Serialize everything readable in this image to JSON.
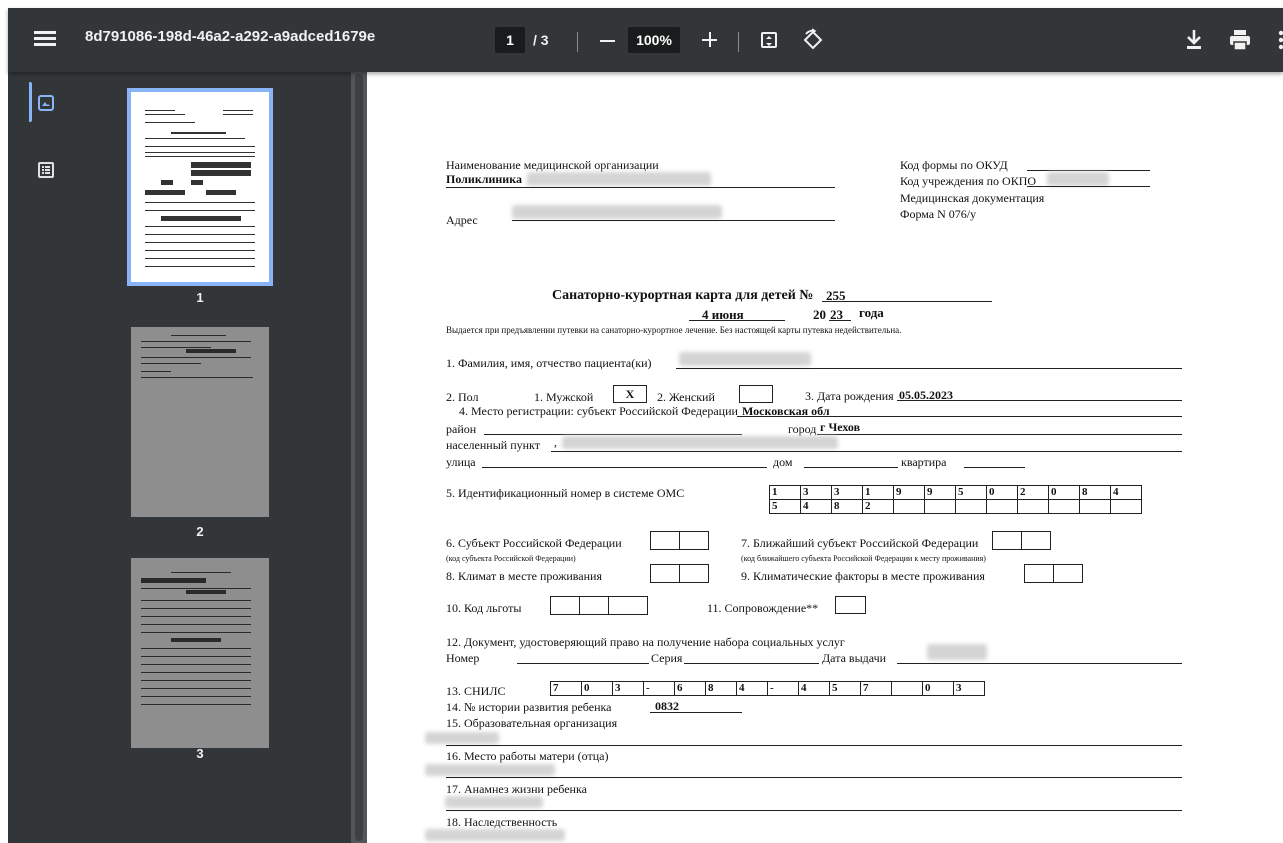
{
  "toolbar": {
    "file_name": "8d791086-198d-46a2-a292-a9adced1679e",
    "page_current": "1",
    "page_total": "/ 3",
    "zoom": "100%"
  },
  "sidebar": {
    "thumbnails": [
      {
        "label": "1"
      },
      {
        "label": "2"
      },
      {
        "label": "3"
      }
    ]
  },
  "doc": {
    "org_label": "Наименование медицинской организации",
    "org_name": "Поликлиника",
    "address_label": "Адрес",
    "okud_label": "Код формы по ОКУД",
    "okpo_label": "Код учреждения по ОКПО",
    "meddoc_label": "Медицинская документация",
    "form_label": "Форма N 076/у",
    "title": "Санаторно-курортная карта для детей №",
    "card_number": "255",
    "date_day": "4 июня",
    "year_prefix": "20",
    "year_suffix": "23",
    "year_word": "года",
    "issue_note": "Выдается при предъявлении путевки на санаторно-курортное лечение. Без настоящей карты путевка недействительна.",
    "f1": "1. Фамилия, имя, отчество пациента(ки)",
    "f2": "2. Пол",
    "male": "1. Мужской",
    "male_mark": "X",
    "female": "2. Женский",
    "birth_label": "3. Дата рождения",
    "birth_value": "05.05.2023",
    "f4": "4. Место регистрации: субъект Российской Федерации",
    "region_value": "Московская обл",
    "district": "район",
    "city_label": "город",
    "city_value": "г Чехов",
    "settlement": "населенный пункт",
    "settlement_value": ",",
    "street": "улица",
    "house": "дом",
    "flat": "квартира",
    "f5": "5. Идентификационный номер в системе ОМС",
    "oms_row1": [
      "1",
      "3",
      "3",
      "1",
      "9",
      "9",
      "5",
      "0",
      "2",
      "0",
      "8",
      "4"
    ],
    "oms_row2": [
      "5",
      "4",
      "8",
      "2",
      "",
      "",
      "",
      "",
      "",
      "",
      "",
      ""
    ],
    "f6": "6. Субъект Российской Федерации",
    "f6_note": "(код субъекта Российской Федерации)",
    "f7": "7. Ближайший субъект Российской Федерации",
    "f7_note": "(код ближайшего субъекта Российской Федерации к месту проживания)",
    "f8": "8. Климат в месте проживания",
    "f9": "9. Климатические факторы в месте проживания",
    "f10": "10. Код льготы",
    "f11": "11. Сопровождение**",
    "f12": "12. Документ, удостоверяющий право на получение набора социальных услуг",
    "number": "Номер",
    "series": "Серия",
    "issue_date": "Дата выдачи",
    "f13": "13. СНИЛС",
    "snils": [
      "7",
      "0",
      "3",
      "-",
      "6",
      "8",
      "4",
      "-",
      "4",
      "5",
      "7",
      "",
      "0",
      "3"
    ],
    "f14": "14. № истории развития ребенка",
    "history_value": "0832",
    "f15": "15. Образовательная организация",
    "f16": "16. Место работы матери (отца)",
    "f17": "17. Анамнез жизни ребенка",
    "f18": "18. Наследственность"
  }
}
